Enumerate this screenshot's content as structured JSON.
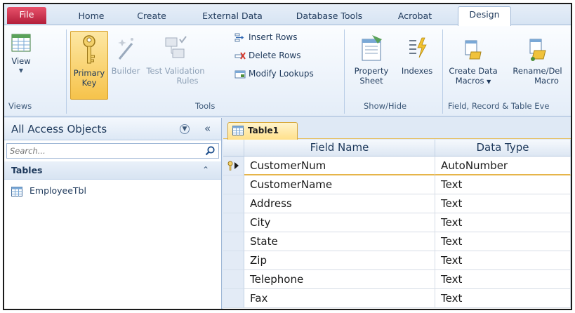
{
  "ribbon_tabs": {
    "file": "File",
    "home": "Home",
    "create": "Create",
    "external_data": "External Data",
    "database_tools": "Database Tools",
    "acrobat": "Acrobat",
    "design": "Design"
  },
  "views_group": {
    "view_label": "View",
    "group_label": "Views"
  },
  "tools_group": {
    "primary_key_line1": "Primary",
    "primary_key_line2": "Key",
    "builder": "Builder",
    "test_validation_line1": "Test Validation",
    "test_validation_line2": "Rules",
    "insert_rows": "Insert Rows",
    "delete_rows": "Delete Rows",
    "modify_lookups": "Modify Lookups",
    "group_label": "Tools"
  },
  "showhide_group": {
    "property_sheet_line1": "Property",
    "property_sheet_line2": "Sheet",
    "indexes": "Indexes",
    "group_label": "Show/Hide"
  },
  "field_events_group": {
    "create_data_macros_line1": "Create Data",
    "create_data_macros_line2": "Macros",
    "rename_delete_macro_line1": "Rename/Del",
    "rename_delete_macro_line2": "Macro",
    "group_label": "Field, Record & Table Eve"
  },
  "nav_pane": {
    "title": "All Access Objects",
    "search_placeholder": "Search...",
    "group_label": "Tables",
    "items": [
      "EmployeeTbl"
    ]
  },
  "document": {
    "tab_label": "Table1",
    "columns": {
      "field_name": "Field Name",
      "data_type": "Data Type"
    },
    "rows": [
      {
        "field": "CustomerNum",
        "type": "AutoNumber",
        "primary_key": true
      },
      {
        "field": "CustomerName",
        "type": "Text"
      },
      {
        "field": "Address",
        "type": "Text"
      },
      {
        "field": "City",
        "type": "Text"
      },
      {
        "field": "State",
        "type": "Text"
      },
      {
        "field": "Zip",
        "type": "Text"
      },
      {
        "field": "Telephone",
        "type": "Text"
      },
      {
        "field": "Fax",
        "type": "Text"
      }
    ]
  },
  "colors": {
    "file_tab": "#c42b47",
    "ribbon_bg": "#e4edf8",
    "accent_highlight": "#f6c34b",
    "text": "#1e395b"
  }
}
